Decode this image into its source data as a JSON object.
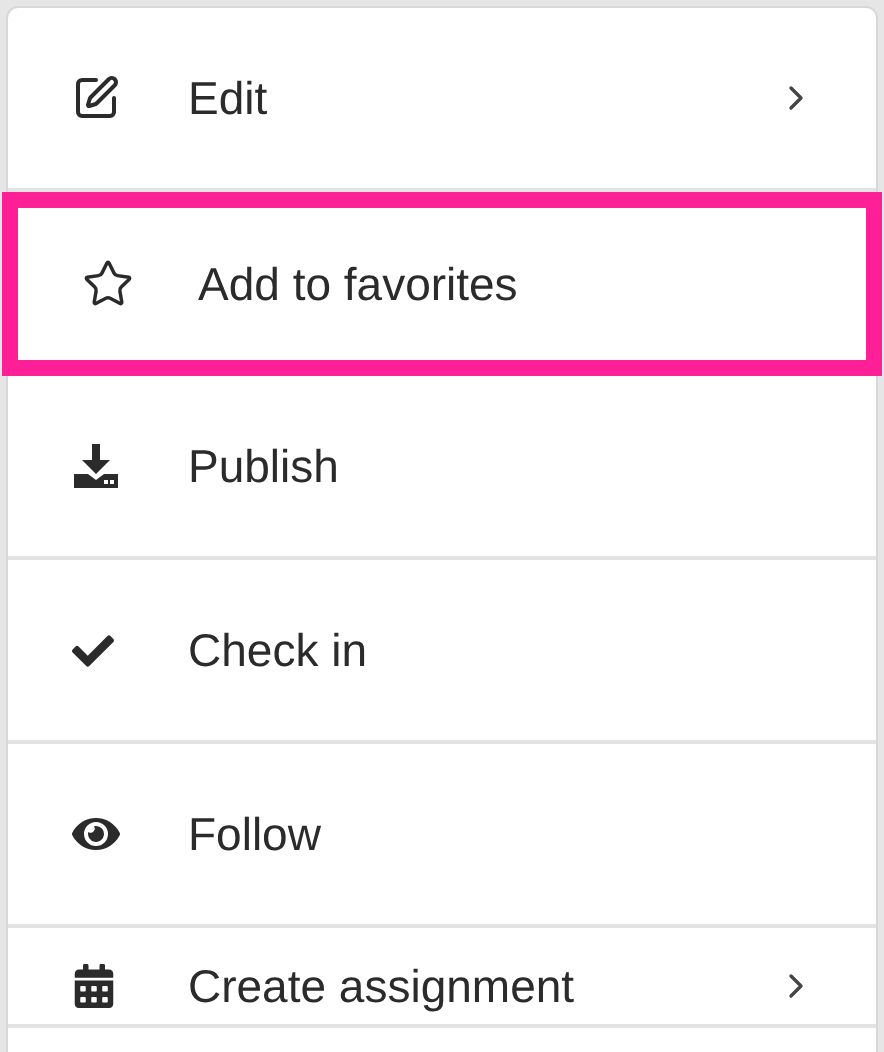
{
  "menu": {
    "items": [
      {
        "label": "Edit",
        "submenu": true,
        "selected": false
      },
      {
        "label": "Add to favorites",
        "submenu": false,
        "selected": true
      },
      {
        "label": "Publish",
        "submenu": false,
        "selected": false
      },
      {
        "label": "Check in",
        "submenu": false,
        "selected": false
      },
      {
        "label": "Follow",
        "submenu": false,
        "selected": false
      },
      {
        "label": "Create assignment",
        "submenu": true,
        "selected": false
      }
    ]
  }
}
